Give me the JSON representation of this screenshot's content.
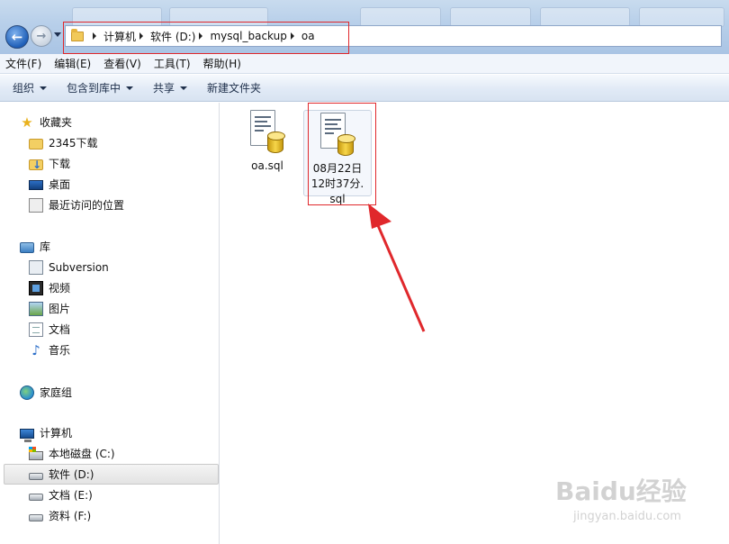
{
  "address": {
    "crumbs": [
      "计算机",
      "软件 (D:)",
      "mysql_backup",
      "oa"
    ]
  },
  "menu": [
    "文件(F)",
    "编辑(E)",
    "查看(V)",
    "工具(T)",
    "帮助(H)"
  ],
  "toolbar": {
    "organize": "组织",
    "include_library": "包含到库中",
    "share": "共享",
    "new_folder": "新建文件夹"
  },
  "sidebar": {
    "favorites": {
      "label": "收藏夹",
      "items": [
        "2345下载",
        "下载",
        "桌面",
        "最近访问的位置"
      ]
    },
    "libraries": {
      "label": "库",
      "items": [
        "Subversion",
        "视频",
        "图片",
        "文档",
        "音乐"
      ]
    },
    "homegroup": {
      "label": "家庭组"
    },
    "computer": {
      "label": "计算机",
      "items": [
        "本地磁盘 (C:)",
        "软件 (D:)",
        "文档 (E:)",
        "资料 (F:)"
      ],
      "selected_index": 1
    }
  },
  "files": [
    {
      "name": "oa.sql",
      "icon": "sql-file-icon"
    },
    {
      "name": "08月22日12时37分.sql",
      "icon": "sql-file-icon",
      "selected": true
    }
  ],
  "watermark": {
    "brand": "Baidu经验",
    "url": "jingyan.baidu.com"
  },
  "colors": {
    "highlight_red": "#e0282c",
    "accent_blue": "#1f5fb8"
  }
}
